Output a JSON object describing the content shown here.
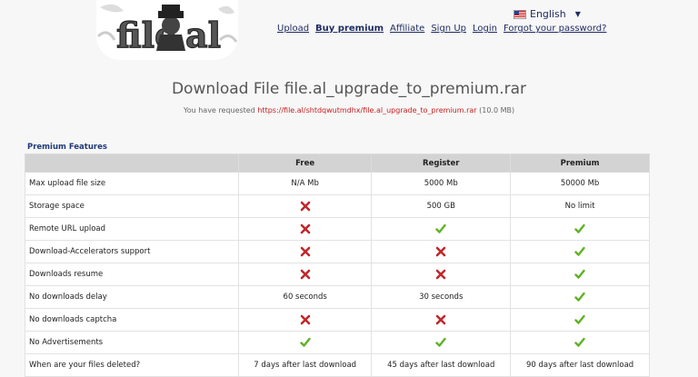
{
  "header": {
    "logo_text": "file.al",
    "language": "English",
    "nav": [
      "Upload",
      "Buy premium",
      "Affiliate",
      "Sign Up",
      "Login",
      "Forgot your password?"
    ]
  },
  "page": {
    "title": "Download File file.al_upgrade_to_premium.rar",
    "request_prefix": "You have requested",
    "request_url": "https://file.al/shtdqwutmdhx/file.al_upgrade_to_premium.rar",
    "request_size": "(10.0 MB)"
  },
  "features": {
    "section_title": "Premium Features",
    "columns": [
      "",
      "Free",
      "Register",
      "Premium"
    ],
    "rows": [
      {
        "label": "Max upload file size",
        "free": "N/A Mb",
        "register": "5000 Mb",
        "premium": "50000 Mb"
      },
      {
        "label": "Storage space",
        "free": "cross-icon",
        "register": "500 GB",
        "premium": "No limit"
      },
      {
        "label": "Remote URL upload",
        "free": "cross-icon",
        "register": "check-icon",
        "premium": "check-icon"
      },
      {
        "label": "Download-Accelerators support",
        "free": "cross-icon",
        "register": "cross-icon",
        "premium": "check-icon"
      },
      {
        "label": "Downloads resume",
        "free": "cross-icon",
        "register": "cross-icon",
        "premium": "check-icon"
      },
      {
        "label": "No downloads delay",
        "free": "60 seconds",
        "register": "30 seconds",
        "premium": "check-icon"
      },
      {
        "label": "No downloads captcha",
        "free": "cross-icon",
        "register": "cross-icon",
        "premium": "check-icon"
      },
      {
        "label": "No Advertisements",
        "free": "check-icon",
        "register": "check-icon",
        "premium": "check-icon"
      },
      {
        "label": "When are your files deleted?",
        "free": "7 days after last download",
        "register": "45 days after last download",
        "premium": "90 days after last download"
      }
    ]
  },
  "colors": {
    "link": "#1f2b63",
    "url": "#c62020",
    "check": "#5fb224",
    "cross": "#c0282b"
  }
}
